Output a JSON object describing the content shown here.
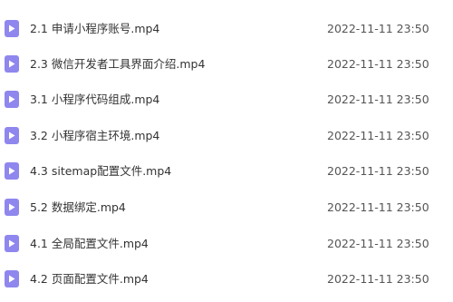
{
  "files": [
    {
      "name": "2.1 申请小程序账号.mp4",
      "modified": "2022-11-11 23:50",
      "icon": "video-file-icon"
    },
    {
      "name": "2.3 微信开发者工具界面介绍.mp4",
      "modified": "2022-11-11 23:50",
      "icon": "video-file-icon"
    },
    {
      "name": "3.1 小程序代码组成.mp4",
      "modified": "2022-11-11 23:50",
      "icon": "video-file-icon"
    },
    {
      "name": "3.2 小程序宿主环境.mp4",
      "modified": "2022-11-11 23:50",
      "icon": "video-file-icon"
    },
    {
      "name": "4.3 sitemap配置文件.mp4",
      "modified": "2022-11-11 23:50",
      "icon": "video-file-icon"
    },
    {
      "name": "5.2 数据绑定.mp4",
      "modified": "2022-11-11 23:50",
      "icon": "video-file-icon"
    },
    {
      "name": "4.1 全局配置文件.mp4",
      "modified": "2022-11-11 23:50",
      "icon": "video-file-icon"
    },
    {
      "name": "4.2 页面配置文件.mp4",
      "modified": "2022-11-11 23:50",
      "icon": "video-file-icon"
    }
  ],
  "colors": {
    "icon": "#8f87ee",
    "name_text": "#333333",
    "date_text": "#555555"
  }
}
